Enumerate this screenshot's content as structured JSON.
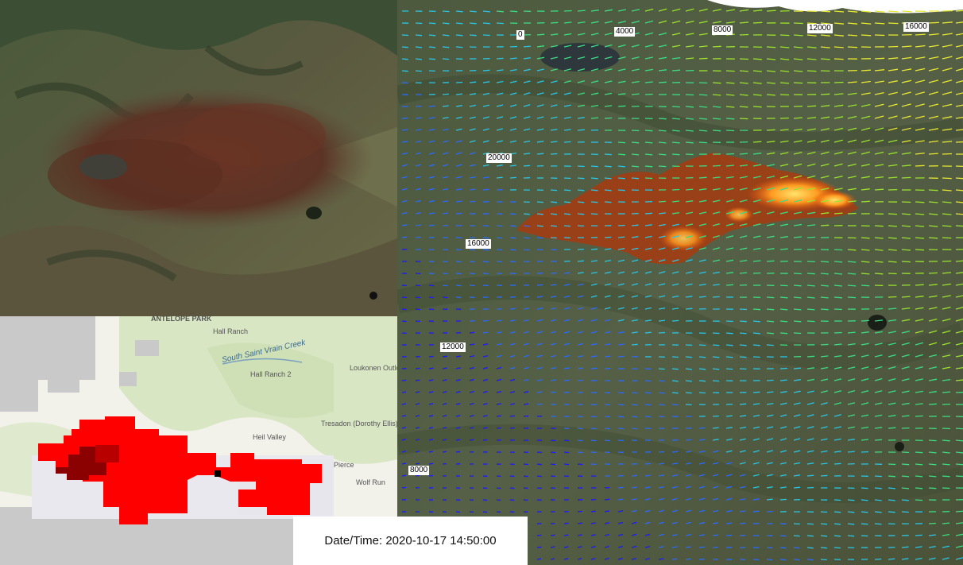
{
  "sim_panel": {
    "axis_labels_top": [
      "0",
      "4000",
      "8000",
      "12000",
      "16000"
    ],
    "axis_labels_left": [
      "20000",
      "16000",
      "12000",
      "8000"
    ],
    "wind_colors": [
      "#1a1aff",
      "#2a6bff",
      "#29c6e6",
      "#3ddc84",
      "#9be22f",
      "#e8e832"
    ]
  },
  "topo_panel": {
    "places": {
      "antelope_park": "ANTELOPE PARK",
      "hall_ranch": "Hall Ranch",
      "south_saint_vrain_creek": "South Saint Vrain Creek",
      "hall_ranch_2": "Hall Ranch 2",
      "loukonen_outlots": "Loukonen Outlots",
      "heil_valley": "Heil Valley",
      "tresadon": "Tresadon (Dorothy Ellis)",
      "pierce": "Pierce",
      "wolf_run": "Wolf Run"
    },
    "fire_color": "#ff0000",
    "fire_dark_color": "#8b0000"
  },
  "timestamp": {
    "label": "Date/Time:",
    "value": "2020-10-17 14:50:00"
  }
}
